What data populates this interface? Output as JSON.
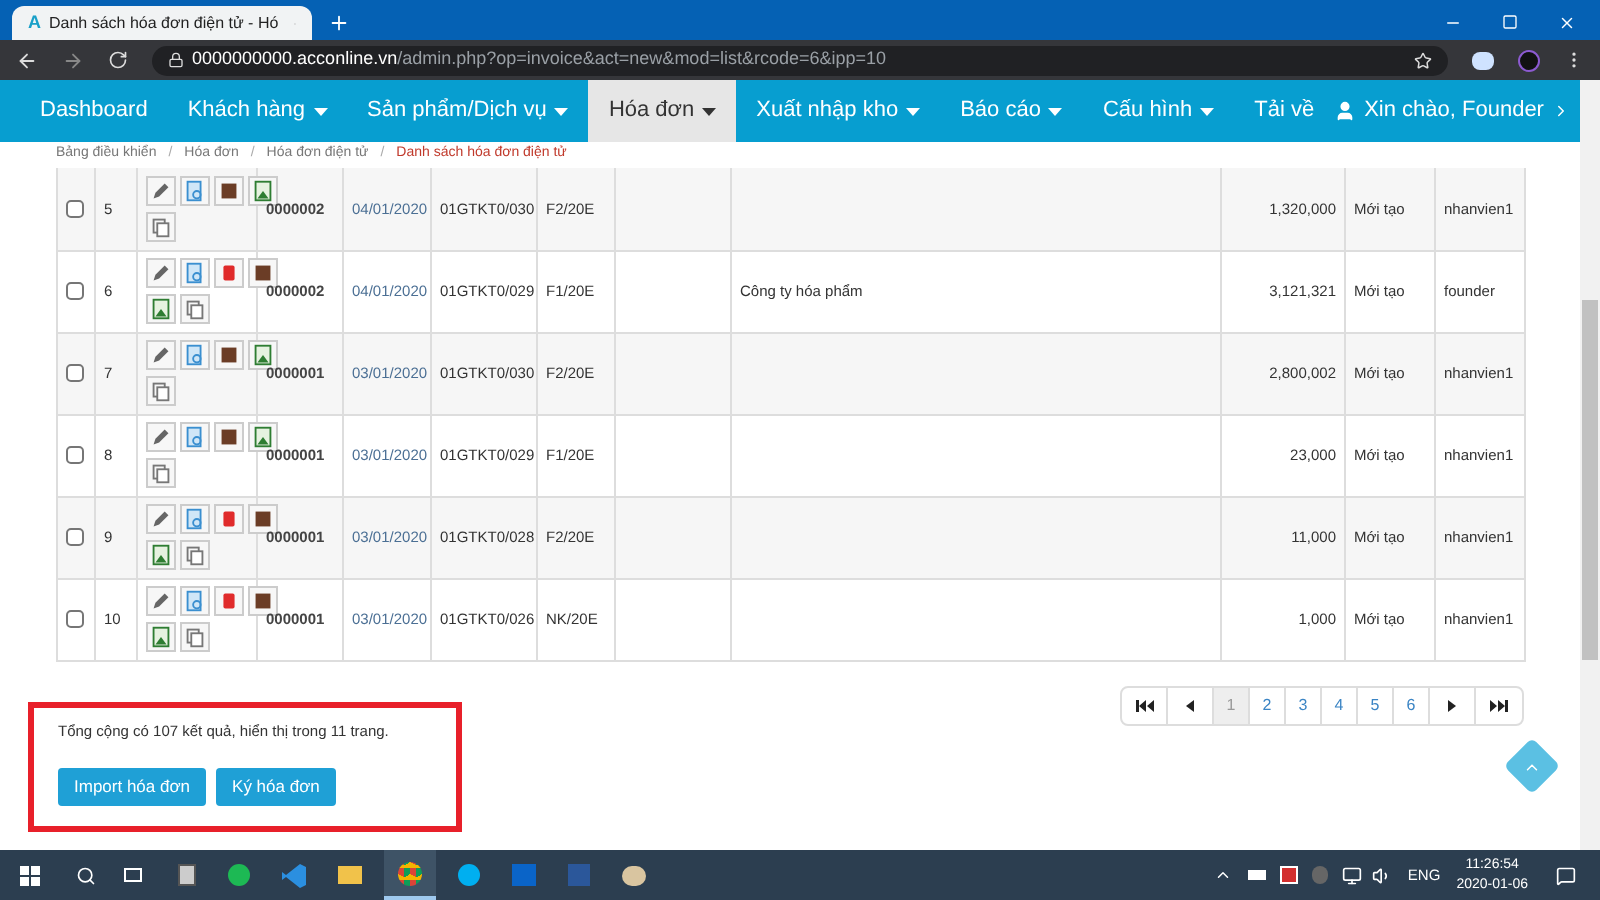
{
  "browser": {
    "tab_logo": "A",
    "tab_title": "Danh sách hóa đơn điện tử - Hó",
    "url_host": "0000000000.acconline.vn",
    "url_path": "/admin.php?op=invoice&act=new&mod=list&rcode=6&ipp=10"
  },
  "nav": {
    "items": [
      {
        "label": "Dashboard",
        "dropdown": false,
        "selected": false
      },
      {
        "label": "Khách hàng",
        "dropdown": true,
        "selected": false
      },
      {
        "label": "Sản phẩm/Dịch vụ",
        "dropdown": true,
        "selected": false
      },
      {
        "label": "Hóa đơn",
        "dropdown": true,
        "selected": true
      },
      {
        "label": "Xuất nhập kho",
        "dropdown": true,
        "selected": false
      },
      {
        "label": "Báo cáo",
        "dropdown": true,
        "selected": false
      },
      {
        "label": "Cấu hình",
        "dropdown": true,
        "selected": false
      },
      {
        "label": "Tải về",
        "dropdown": false,
        "selected": false
      }
    ],
    "user": "Xin chào, Founder"
  },
  "breadcrumb": {
    "separator": "/",
    "items": [
      "Bảng điều khiển",
      "Hóa đơn",
      "Hóa đơn điện tử",
      "Danh sách hóa đơn điện tử"
    ]
  },
  "table": {
    "rows": [
      {
        "checked": false,
        "no": "5",
        "deletable": false,
        "code": "0000002",
        "date": "04/01/2020",
        "template": "01GTKT0/030",
        "serial": "F2/20E",
        "customer": "",
        "amount": "1,320,000",
        "status": "Mới tạo",
        "user": "nhanvien1"
      },
      {
        "checked": false,
        "no": "6",
        "deletable": true,
        "code": "0000002",
        "date": "04/01/2020",
        "template": "01GTKT0/029",
        "serial": "F1/20E",
        "customer": "Công ty hóa phẩm",
        "amount": "3,121,321",
        "status": "Mới tạo",
        "user": "founder"
      },
      {
        "checked": false,
        "no": "7",
        "deletable": false,
        "code": "0000001",
        "date": "03/01/2020",
        "template": "01GTKT0/030",
        "serial": "F2/20E",
        "customer": "",
        "amount": "2,800,002",
        "status": "Mới tạo",
        "user": "nhanvien1"
      },
      {
        "checked": false,
        "no": "8",
        "deletable": false,
        "code": "0000001",
        "date": "03/01/2020",
        "template": "01GTKT0/029",
        "serial": "F1/20E",
        "customer": "",
        "amount": "23,000",
        "status": "Mới tạo",
        "user": "nhanvien1"
      },
      {
        "checked": false,
        "no": "9",
        "deletable": true,
        "code": "0000001",
        "date": "03/01/2020",
        "template": "01GTKT0/028",
        "serial": "F2/20E",
        "customer": "",
        "amount": "11,000",
        "status": "Mới tạo",
        "user": "nhanvien1"
      },
      {
        "checked": false,
        "no": "10",
        "deletable": true,
        "code": "0000001",
        "date": "03/01/2020",
        "template": "01GTKT0/026",
        "serial": "NK/20E",
        "customer": "",
        "amount": "1,000",
        "status": "Mới tạo",
        "user": "nhanvien1"
      }
    ]
  },
  "summary": "Tổng cộng có 107 kết quả, hiển thị trong 11 trang.",
  "buttons": [
    "Import hóa đơn",
    "Ký hóa đơn"
  ],
  "pagination": [
    {
      "label": "1",
      "selected": true
    },
    {
      "label": "2",
      "selected": false
    },
    {
      "label": "3",
      "selected": false
    },
    {
      "label": "4",
      "selected": false
    },
    {
      "label": "5",
      "selected": false
    },
    {
      "label": "6",
      "selected": false
    }
  ],
  "taskbar": {
    "language": "ENG",
    "time": "11:26:54",
    "date": "2020-01-06"
  }
}
